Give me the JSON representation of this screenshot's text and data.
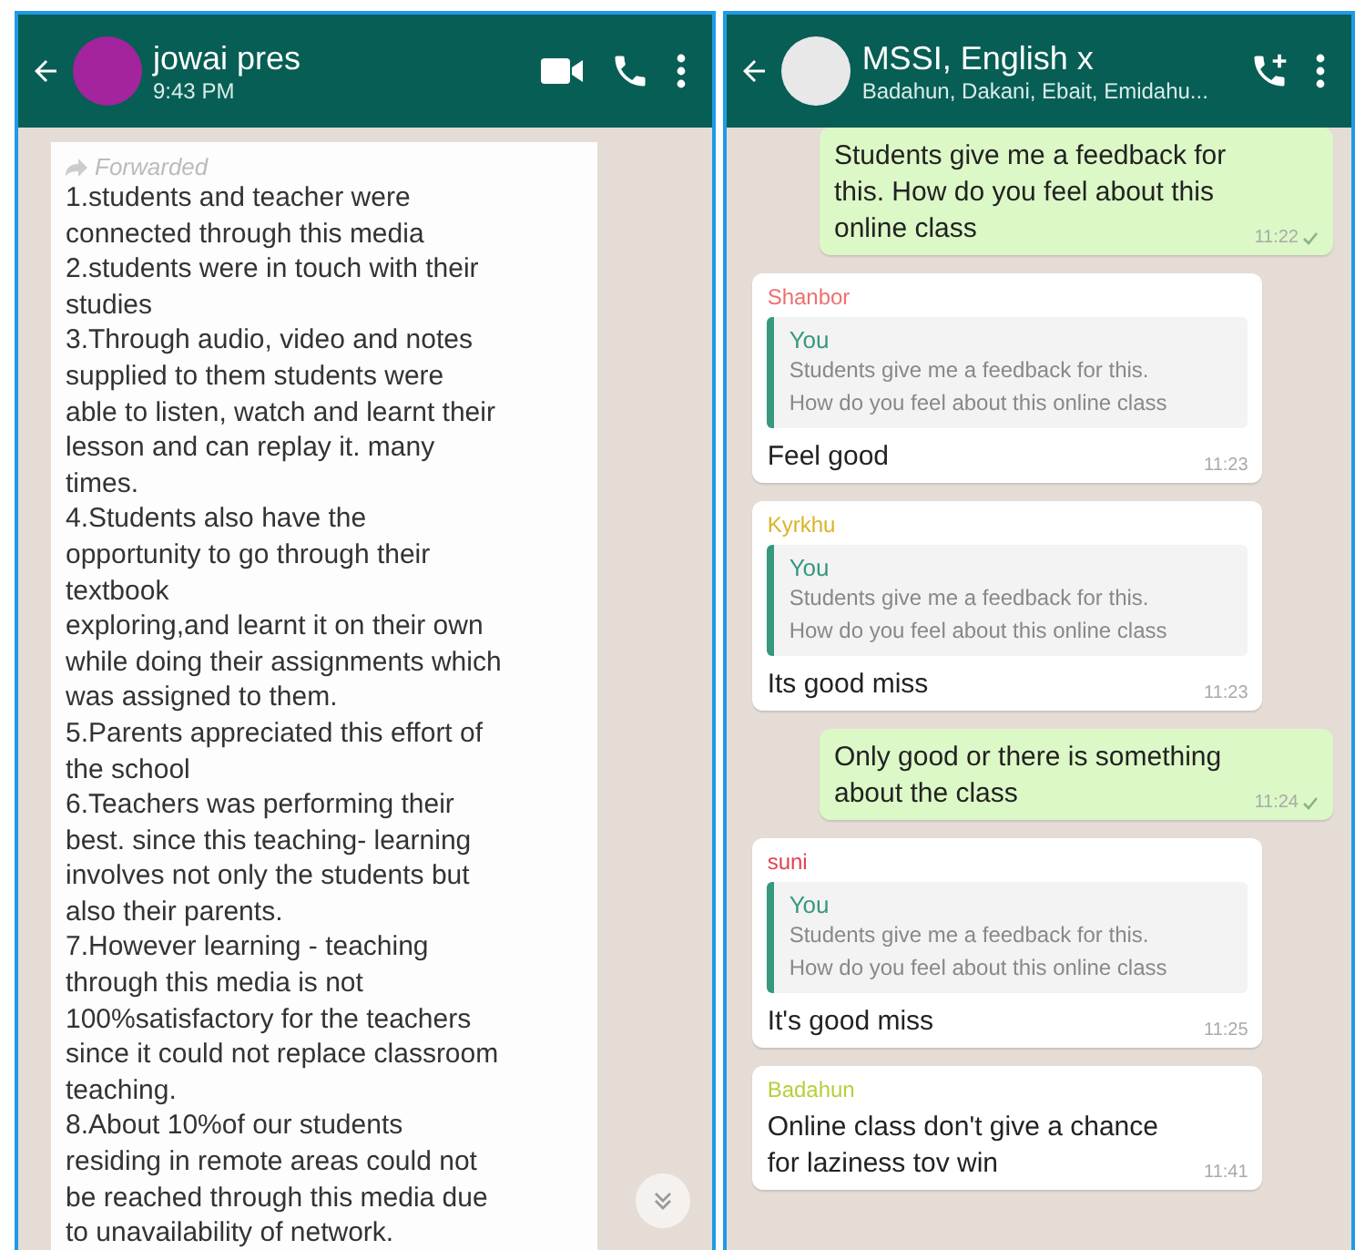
{
  "left_chat": {
    "header": {
      "title": "jowai pres",
      "subtitle": "9:43 PM"
    },
    "message": {
      "forwarded_label": "Forwarded",
      "text": "1.students and teacher were\nconnected through this media\n2.students were in touch with their\nstudies\n3.Through audio, video and notes\nsupplied to them students were\nable to listen, watch and learnt their\nlesson and can replay it. many\ntimes.\n4.Students also have the\nopportunity to go through their\ntextbook\nexploring,and learnt it on their own\nwhile doing their assignments which\nwas assigned to them.\n5.Parents appreciated this effort of\nthe school\n6.Teachers was performing their\nbest. since this teaching- learning\ninvolves not only the students but\nalso their parents.\n7.However learning - teaching\nthrough this media is not\n100%satisfactory for the teachers\nsince it could not replace classroom\nteaching.\n8.About 10%of our students\nresiding in remote areas could not\nbe reached through this media due\nto unavailability of network."
    }
  },
  "right_chat": {
    "header": {
      "title": "MSSI,  English x",
      "subtitle": "Badahun, Dakani, Ebait, Emidahu..."
    },
    "messages": [
      {
        "kind": "outgoing",
        "text": "Students give me a feedback for this. How do you feel about this online class",
        "time": "11:22",
        "sent": true
      },
      {
        "kind": "incoming",
        "sender": "Shanbor",
        "color": "#ef6f6f",
        "quote": {
          "author": "You",
          "text": "Students give me a feedback for this.\nHow do you feel about this online class"
        },
        "text": "Feel good",
        "time": "11:23"
      },
      {
        "kind": "incoming",
        "sender": "Kyrkhu",
        "color": "#d8b526",
        "quote": {
          "author": "You",
          "text": "Students give me a feedback for this.\nHow do you feel about this online class"
        },
        "text": "Its good miss",
        "time": "11:23"
      },
      {
        "kind": "outgoing",
        "text": "Only good or there is something about the class",
        "time": "11:24",
        "sent": true
      },
      {
        "kind": "incoming",
        "sender": "suni",
        "color": "#e0434f",
        "quote": {
          "author": "You",
          "text": "Students give me a feedback for this.\nHow do you feel about this online class"
        },
        "text": "It's good miss",
        "time": "11:25"
      },
      {
        "kind": "incoming",
        "sender": "Badahun",
        "color": "#b7cf3c",
        "text": "Online class don't give a chance for laziness tov win",
        "time": "11:41"
      }
    ]
  }
}
